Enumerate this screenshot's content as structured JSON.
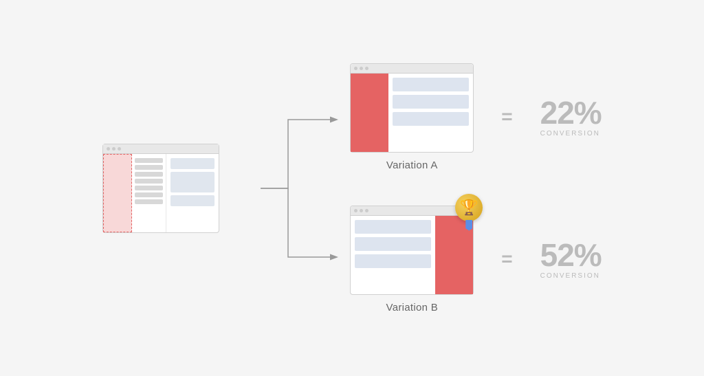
{
  "source": {
    "label": "source-page"
  },
  "variations": [
    {
      "id": "variation-a",
      "label": "Variation A",
      "conversion_percent": "22%",
      "conversion_label": "CONVERSION",
      "has_trophy": false,
      "layout": "red-left"
    },
    {
      "id": "variation-b",
      "label": "Variation B",
      "conversion_percent": "52%",
      "conversion_label": "CONVERSION",
      "has_trophy": true,
      "layout": "red-right"
    }
  ],
  "equals_symbol": "=",
  "trophy_icon": "🏆"
}
